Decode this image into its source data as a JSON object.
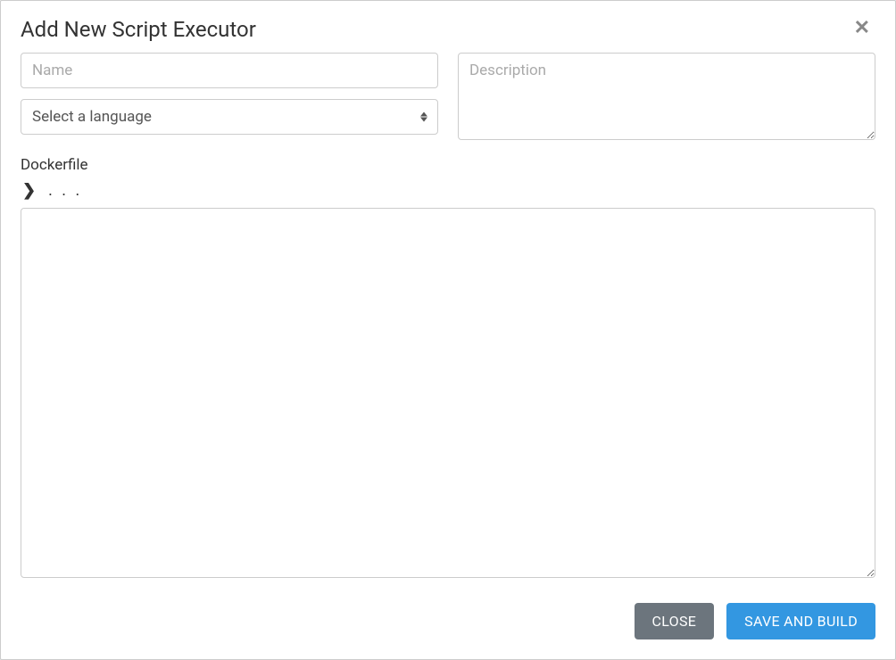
{
  "modal": {
    "title": "Add New Script Executor",
    "name_placeholder": "Name",
    "name_value": "",
    "language_placeholder": "Select a language",
    "description_placeholder": "Description",
    "description_value": "",
    "dockerfile_label": "Dockerfile",
    "folded_indicator": ". . .",
    "dockerfile_value": ""
  },
  "footer": {
    "close_label": "CLOSE",
    "save_label": "SAVE AND BUILD"
  }
}
